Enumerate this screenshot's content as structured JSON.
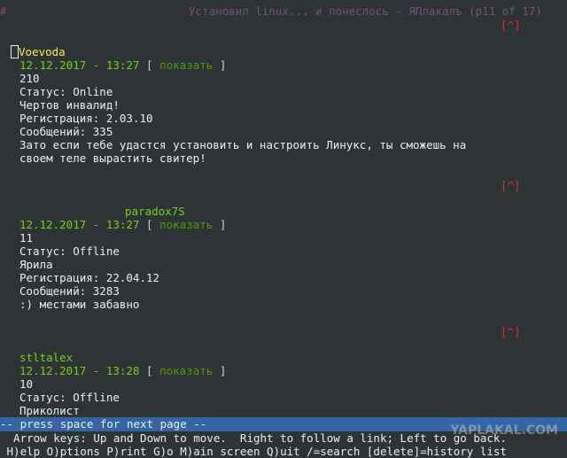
{
  "header": {
    "hash": "#",
    "title": "Установил linux... и понеслось - ЯПлакалъ (p11 of 17)"
  },
  "up_link": "[^]",
  "posts": [
    {
      "user": "Voevoda",
      "date": "12.12.2017 - 13:27",
      "open": "[",
      "show": "показать",
      "close": "]",
      "lines": [
        "210",
        "Статус: Online",
        "Чертов инвалид!",
        "Регистрация: 2.03.10",
        "Сообщений: 335"
      ],
      "text": [
        "Зато если тебе удастся установить и настроить Линукс, ты сможешь на",
        "своем теле вырастить свитер!"
      ]
    },
    {
      "user": "paradox7S",
      "date": "12.12.2017 - 13:27",
      "open": "[",
      "show": "показать",
      "close": "]",
      "lines": [
        "11",
        "Статус: Offline",
        "Ярила",
        "Регистрация: 22.04.12",
        "Сообщений: 3283"
      ],
      "text": [
        ":) местами забавно"
      ]
    },
    {
      "user": "stltalex",
      "date": "12.12.2017 - 13:28",
      "open": "[",
      "show": "показать",
      "close": "]",
      "lines": [
        "10",
        "Статус: Offline",
        "Приколист"
      ]
    }
  ],
  "statusbar": "-- press space for next page --",
  "help": {
    "line1": "  Arrow keys: Up and Down to move.  Right to follow a link; Left to go back.",
    "line2": " H)elp O)ptions P)rint G)o M)ain screen Q)uit /=search [delete]=history list"
  },
  "watermark": "YAPLAKAL.COM"
}
